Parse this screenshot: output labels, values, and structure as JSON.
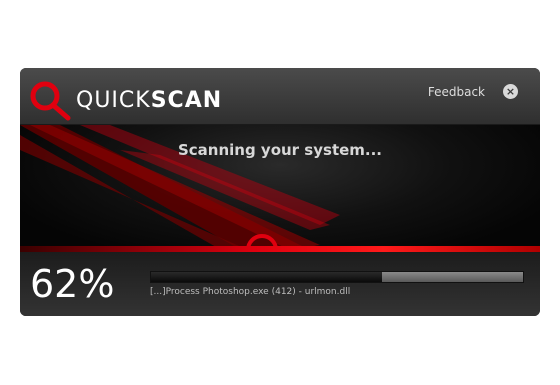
{
  "app": {
    "brand_light": "QUICK",
    "brand_bold": "SCAN"
  },
  "header": {
    "feedback_label": "Feedback",
    "close_label": "×"
  },
  "status": {
    "heading": "Scanning your system..."
  },
  "progress": {
    "percent_label": "62%",
    "fraction": 0.62,
    "current_item": "[...]Process Photoshop.exe (412) - urlmon.dll"
  },
  "colors": {
    "accent": "#e0000f",
    "titlebar": "#3d3d3d",
    "panel": "#0b0b0b"
  },
  "icons": {
    "logo": "magnifier-logo-icon",
    "close": "close-icon",
    "scan": "magnifier-icon"
  }
}
